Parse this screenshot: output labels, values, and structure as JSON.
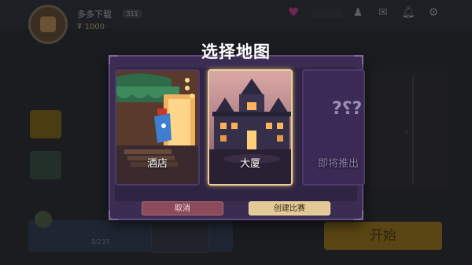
{
  "player": {
    "name": "多多下载",
    "level": "311",
    "coins": "1000"
  },
  "top_icons": [
    "heart-icon",
    "character-icon",
    "mail-icon",
    "notification-icon",
    "settings-icon"
  ],
  "lobby": {
    "start_label": "开始",
    "progress": "0/233"
  },
  "modal": {
    "title": "选择地图",
    "maps": [
      {
        "label": "酒店",
        "selected": false
      },
      {
        "label": "大厦",
        "selected": true
      },
      {
        "label": "即将推出",
        "selected": false
      }
    ],
    "cancel_label": "取消",
    "create_label": "创建比赛"
  },
  "colors": {
    "modal_bg": "#3b2d52",
    "selected_border": "#e8cf9a",
    "cancel_button": "#8c4b5a",
    "create_button": "#e3c995"
  }
}
